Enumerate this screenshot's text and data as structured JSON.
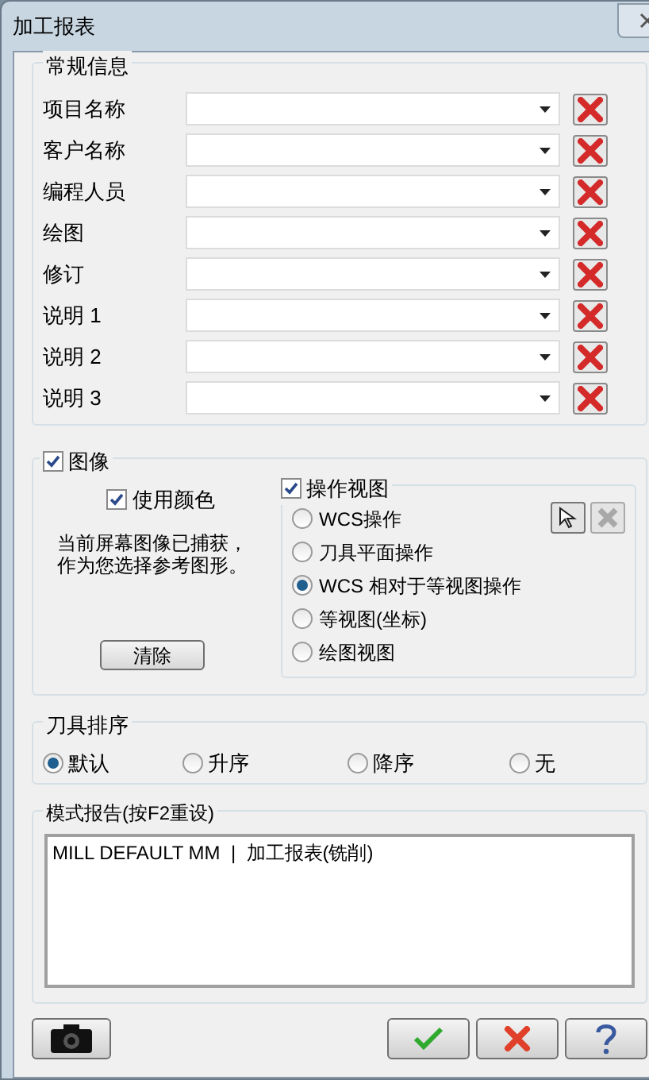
{
  "window": {
    "title": "加工报表"
  },
  "general_info": {
    "title": "常规信息",
    "fields": [
      {
        "label": "项目名称"
      },
      {
        "label": "客户名称"
      },
      {
        "label": "编程人员"
      },
      {
        "label": "绘图"
      },
      {
        "label": "修订"
      },
      {
        "label": "说明 1"
      },
      {
        "label": "说明 2"
      },
      {
        "label": "说明 3"
      }
    ]
  },
  "image": {
    "label": "图像",
    "checked": true,
    "use_color": {
      "label": "使用颜色",
      "checked": true
    },
    "message_lines": [
      "当前屏幕图像已捕获，",
      "作为您选择参考图形。"
    ],
    "clear_button": "清除",
    "operation_view": {
      "label": "操作视图",
      "checked": true,
      "options": [
        {
          "label": "WCS操作",
          "selected": false
        },
        {
          "label": "刀具平面操作",
          "selected": false
        },
        {
          "label": "WCS 相对于等视图操作",
          "selected": true
        },
        {
          "label": "等视图(坐标)",
          "selected": false
        },
        {
          "label": "绘图视图",
          "selected": false
        }
      ]
    }
  },
  "tool_sort": {
    "title": "刀具排序",
    "options": [
      {
        "label": "默认",
        "selected": true
      },
      {
        "label": "升序",
        "selected": false
      },
      {
        "label": "降序",
        "selected": false
      },
      {
        "label": "无",
        "selected": false
      }
    ]
  },
  "mode_report": {
    "title": "模式报告(按F2重设)",
    "text": "MILL DEFAULT MM  |  加工报表(铣削)"
  }
}
